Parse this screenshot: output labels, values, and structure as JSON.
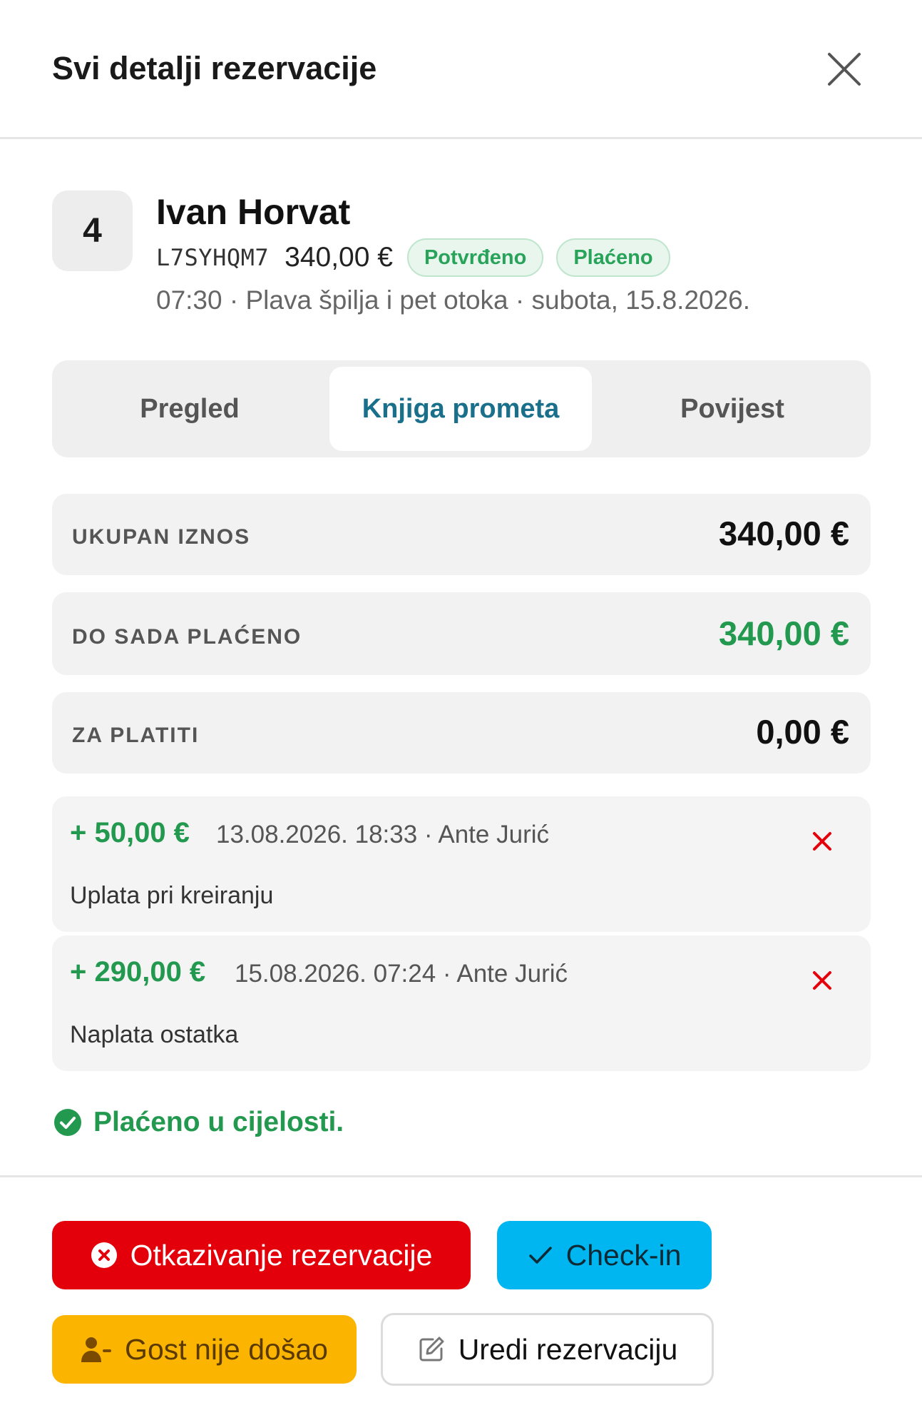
{
  "header": {
    "title": "Svi detalji rezervacije",
    "close_icon": "close-icon"
  },
  "reservation": {
    "party_size": "4",
    "guest_name": "Ivan Horvat",
    "code": "L7SYHQM7",
    "price": "340,00 €",
    "badges": [
      "Potvrđeno",
      "Plaćeno"
    ],
    "tour_line": "07:30 · Plava špilja i pet otoka · subota, 15.8.2026."
  },
  "tabs": [
    {
      "label": "Pregled",
      "active": false
    },
    {
      "label": "Knjiga prometa",
      "active": true
    },
    {
      "label": "Povijest",
      "active": false
    }
  ],
  "summary": [
    {
      "label": "UKUPAN IZNOS",
      "value": "340,00 €"
    },
    {
      "label": "DO SADA PLAĆENO",
      "value": "340,00 €"
    },
    {
      "label": "ZA PLATITI",
      "value": "0,00 €"
    }
  ],
  "payments": [
    {
      "amount": "+ 50,00 €",
      "info": "13.08.2026. 18:33 · Ante Jurić",
      "note": "Uplata pri kreiranju"
    },
    {
      "amount": "+ 290,00 €",
      "info": "15.08.2026. 07:24 · Ante Jurić",
      "note": "Naplata ostatka"
    }
  ],
  "paid_status": "Plaćeno u cijelosti.",
  "actions": {
    "cancel": "Otkazivanje rezervacije",
    "checkin": "Check-in",
    "no_show": "Gost nije došao",
    "edit": "Uredi rezervaciju"
  },
  "colors": {
    "accent_teal": "#1a6f8a",
    "success_green": "#23994f",
    "danger_red": "#e3000b",
    "checkin_blue": "#00b6f0",
    "warning_yellow": "#fbb500"
  }
}
